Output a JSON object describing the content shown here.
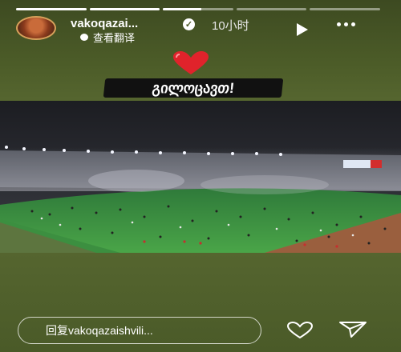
{
  "story": {
    "progress": [
      1,
      1,
      0.55,
      0,
      0
    ],
    "user": {
      "username": "vakoqazai...",
      "verified_glyph": "✓",
      "time_ago": "10小时",
      "translate_label": "查看翻译"
    },
    "stickers": {
      "heart": "heart-icon",
      "text": "გილოცავთ!"
    },
    "media": {
      "description_icon": "stadium-photo",
      "banner_text": ""
    }
  },
  "footer": {
    "reply_placeholder": "回复vakoqazaishvili...",
    "like_icon": "heart-outline-icon",
    "send_icon": "paper-plane-icon"
  },
  "colors": {
    "background": "#55652f",
    "accent": "#e0232b",
    "white": "#ffffff"
  }
}
